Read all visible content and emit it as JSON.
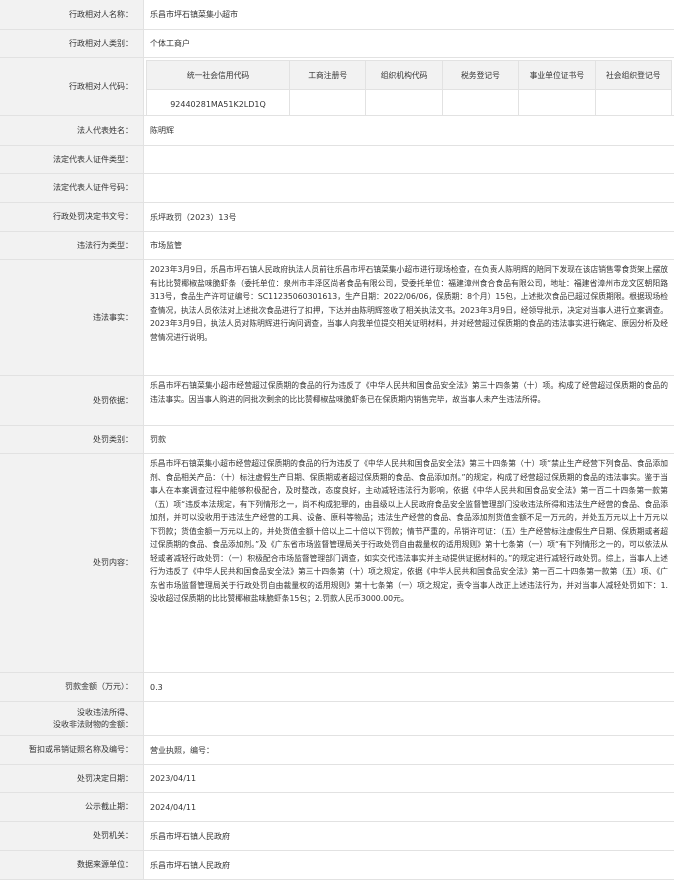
{
  "rows": {
    "name": {
      "label": "行政相对人名称：",
      "value": "乐昌市坪石镇菜集小超市"
    },
    "category": {
      "label": "行政相对人类别：",
      "value": "个体工商户"
    },
    "code": {
      "label": "行政相对人代码："
    },
    "legal_rep": {
      "label": "法人代表姓名：",
      "value": "陈明辉"
    },
    "id_type": {
      "label": "法定代表人证件类型：",
      "value": ""
    },
    "id_no": {
      "label": "法定代表人证件号码：",
      "value": ""
    },
    "doc_no": {
      "label": "行政处罚决定书文号：",
      "value": "乐坪政罚（2023）13号"
    },
    "violation_type": {
      "label": "违法行为类型：",
      "value": "市场监管"
    },
    "facts": {
      "label": "违法事实：",
      "value": "2023年3月9日，乐昌市坪石镇人民政府执法人员前往乐昌市坪石镇菜集小超市进行现场检查，在负责人陈明辉的陪同下发现在该店销售零食货架上摆放有比比赞椰椒盐味脆虾条（委托单位：泉州市丰泽区尚者食品有限公司，受委托单位：福建漳州食合食品有限公司，地址：福建省漳州市龙文区朝阳路313号，食品生产许可证编号：SC11235060301613，生产日期：2022/06/06，保质期：8个月）15包，上述批次食品已超过保质期限。根据现场检查情况，执法人员依法对上述批次食品进行了扣押，下达并由陈明辉签收了相关执法文书。2023年3月9日，经领导批示，决定对当事人进行立案调查。2023年3月9日，执法人员对陈明辉进行询问调查，当事人向我单位提交相关证明材料，并对经营超过保质期的食品的违法事实进行确定、原因分析及经营情况进行说明。"
    },
    "basis": {
      "label": "处罚依据：",
      "value": "乐昌市坪石镇菜集小超市经营超过保质期的食品的行为违反了《中华人民共和国食品安全法》第三十四条第（十）项。构成了经营超过保质期的食品的违法事实。因当事人购进的同批次剩余的比比赞椰椒盐味脆虾条已在保质期内销售完毕，故当事人未产生违法所得。"
    },
    "penalty_category": {
      "label": "处罚类别：",
      "value": "罚款"
    },
    "content": {
      "label": "处罚内容：",
      "value": "乐昌市坪石镇菜集小超市经营超过保质期的食品的行为违反了《中华人民共和国食品安全法》第三十四条第（十）项“禁止生产经营下列食品、食品添加剂、食品相关产品：（十）标注虚假生产日期、保质期或者超过保质期的食品、食品添加剂。”的规定，构成了经营超过保质期的食品的违法事实。鉴于当事人在本案调查过程中能够积极配合，及时整改，态度良好，主动减轻违法行为影响，依据《中华人民共和国食品安全法》第一百二十四条第一款第（五）项“违反本法规定，有下列情形之一，尚不构成犯罪的，由县级以上人民政府食品安全监督管理部门没收违法所得和违法生产经营的食品、食品添加剂，并可以没收用于违法生产经营的工具、设备、原料等物品；违法生产经营的食品、食品添加剂货值金额不足一万元的，并处五万元以上十万元以下罚款；货值金额一万元以上的，并处货值金额十倍以上二十倍以下罚款；情节严重的，吊销许可证：（五）生产经营标注虚假生产日期、保质期或者超过保质期的食品、食品添加剂。”及《广东省市场监督管理局关于行政处罚自由裁量权的适用规则》第十七条第（一）项“有下列情形之一的，可以依法从轻或者减轻行政处罚：（一）积极配合市场监督管理部门调查，如实交代违法事实并主动提供证据材料的。”的规定进行减轻行政处罚。综上，当事人上述行为违反了《中华人民共和国食品安全法》第三十四条第（十）项之规定，依据《中华人民共和国食品安全法》第一百二十四条第一款第（五）项、《广东省市场监督管理局关于行政处罚自由裁量权的适用规则》第十七条第（一）项之规定，责令当事人改正上述违法行为，并对当事人减轻处罚如下：1.没收超过保质期的比比赞椰椒盐味脆虾条15包；2.罚款人民币3000.00元。"
    },
    "fine": {
      "label": "罚款金额（万元）：",
      "value": "0.3"
    },
    "confiscated": {
      "label1": "没收违法所得、",
      "label2": "没收非法财物的金额：",
      "value": ""
    },
    "suspension": {
      "label": "暂扣或吊销证照名称及编号：",
      "value": "营业执照，编号："
    },
    "decision_date": {
      "label": "处罚决定日期：",
      "value": "2023/04/11"
    },
    "deadline": {
      "label": "公示截止期：",
      "value": "2024/04/11"
    },
    "authority": {
      "label": "处罚机关：",
      "value": "乐昌市坪石镇人民政府"
    },
    "source": {
      "label": "数据来源单位：",
      "value": "乐昌市坪石镇人民政府"
    }
  },
  "code_table": {
    "headers": [
      "统一社会信用代码",
      "工商注册号",
      "组织机构代码",
      "税务登记号",
      "事业单位证书号",
      "社会组织登记号"
    ],
    "values": [
      "92440281MA51K2LD1Q",
      "",
      "",
      "",
      "",
      ""
    ]
  }
}
